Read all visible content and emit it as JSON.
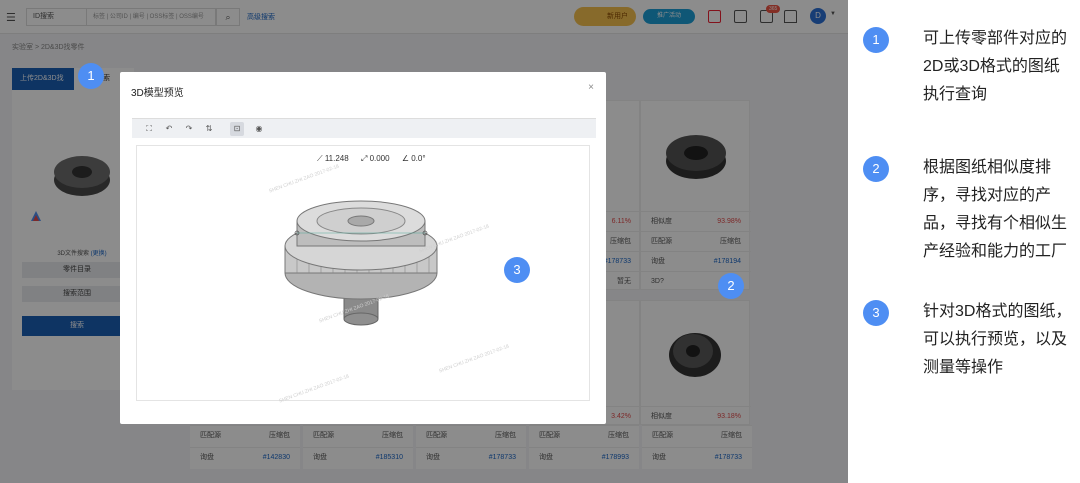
{
  "topbar": {
    "select_value": "ID搜索",
    "search_placeholder": "标签 | 公司ID | 编号 | OSS标签 | OSS编号",
    "advanced_search": "高级搜索",
    "promo1": "新用户",
    "promo2": "推广活动",
    "badge": "365",
    "avatar": "D"
  },
  "breadcrumb": "实验室 > 2D&3D找零件",
  "tabs": [
    "上传2D&3D找",
    "图纸搜索"
  ],
  "left_panel": {
    "upload_label_prefix": "3D文件搜索",
    "upload_label_link": "(更换)",
    "btn1": "零件目录",
    "btn2": "搜索范围",
    "search": "搜索"
  },
  "cards": {
    "similarity_label": "相似度",
    "source_label": "匹配源",
    "source_value": "压缩包",
    "query_label": "询盘",
    "threed_label": "3D?",
    "none_value": "暂无",
    "top_row": [
      {
        "similarity": "93.98%",
        "id": "#178194"
      }
    ],
    "mid_similarity": "6.11%",
    "mid_id": "#178733",
    "bottom_similarities": [
      "3.42%",
      "93.18%"
    ],
    "bottom_ids": [
      "#142830",
      "#185310",
      "#178733",
      "#178993",
      "#178733"
    ]
  },
  "modal": {
    "title": "3D模型预览",
    "close": "×",
    "measure": {
      "distance": "11.248",
      "delta": "0.000",
      "angle": "0.0°"
    },
    "watermark": "SHEN CHU ZHI ZAO 2017-02-18"
  },
  "markers": [
    "1",
    "2",
    "3"
  ],
  "notes": [
    {
      "num": "1",
      "text": "可上传零部件对应的2D或3D格式的图纸执行查询"
    },
    {
      "num": "2",
      "text": "根据图纸相似度排序，寻找对应的产品，寻找有个相似生产经验和能力的工厂"
    },
    {
      "num": "3",
      "text": "针对3D格式的图纸，可以执行预览，以及测量等操作"
    }
  ]
}
